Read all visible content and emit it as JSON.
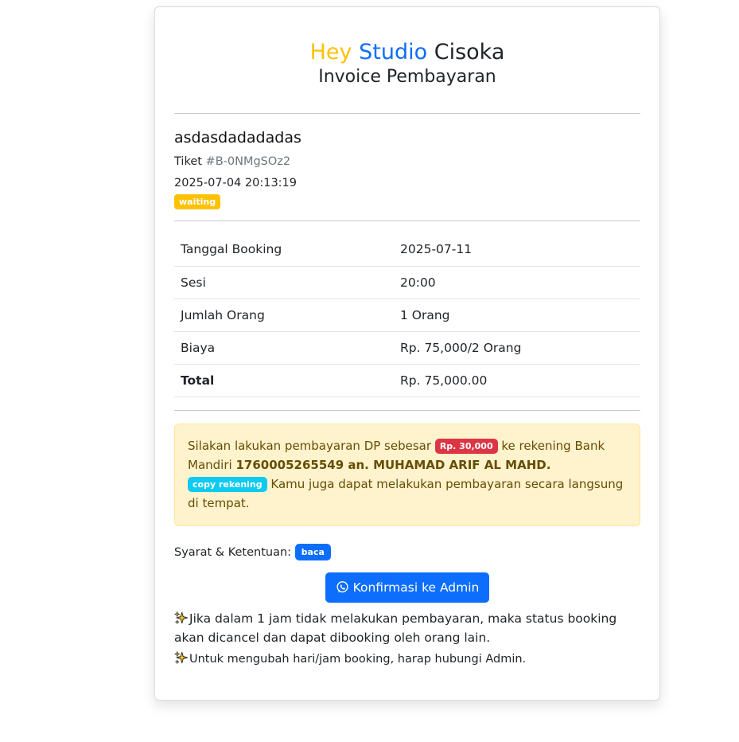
{
  "header": {
    "brand_word1": "Hey",
    "brand_word2": "Studio",
    "brand_word3": "Cisoka",
    "subtitle": "Invoice Pembayaran"
  },
  "booking": {
    "name": "asdasdadadadas",
    "ticket_label": "Tiket",
    "ticket_code": "#B-0NMgSOz2",
    "datetime": "2025-07-04 20:13:19",
    "status": "waiting"
  },
  "details": [
    {
      "label": "Tanggal Booking",
      "value": "2025-07-11"
    },
    {
      "label": "Sesi",
      "value": "20:00"
    },
    {
      "label": "Jumlah Orang",
      "value": "1 Orang"
    },
    {
      "label": "Biaya",
      "value": "Rp. 75,000/2 Orang"
    },
    {
      "label": "Total",
      "value": "Rp. 75,000.00"
    }
  ],
  "payment": {
    "text1": "Silakan lakukan pembayaran DP sebesar",
    "dp_amount": "Rp. 30,000",
    "text2": "ke rekening Bank Mandiri",
    "account": "1760005265549 an. MUHAMAD ARIF AL MAHD.",
    "copy_label": "copy rekening",
    "text3": "Kamu juga dapat melakukan pembayaran secara langsung di tempat."
  },
  "terms": {
    "label": "Syarat & Ketentuan:",
    "link": "baca"
  },
  "confirm_button": "Konfirmasi ke Admin",
  "notes": {
    "note1": "Jika dalam 1 jam tidak melakukan pembayaran, maka status booking akan dicancel dan dapat dibooking oleh orang lain.",
    "note2": "Untuk mengubah hari/jam booking, harap hubungi Admin."
  },
  "colors": {
    "brand_yellow": "#ffc107",
    "brand_blue": "#0d6efd",
    "danger": "#dc3545",
    "info": "#0dcaf0",
    "alert_bg": "#fff3cd"
  },
  "icons": {
    "whatsapp": "whatsapp-icon",
    "sparkles": "sparkles-icon"
  }
}
